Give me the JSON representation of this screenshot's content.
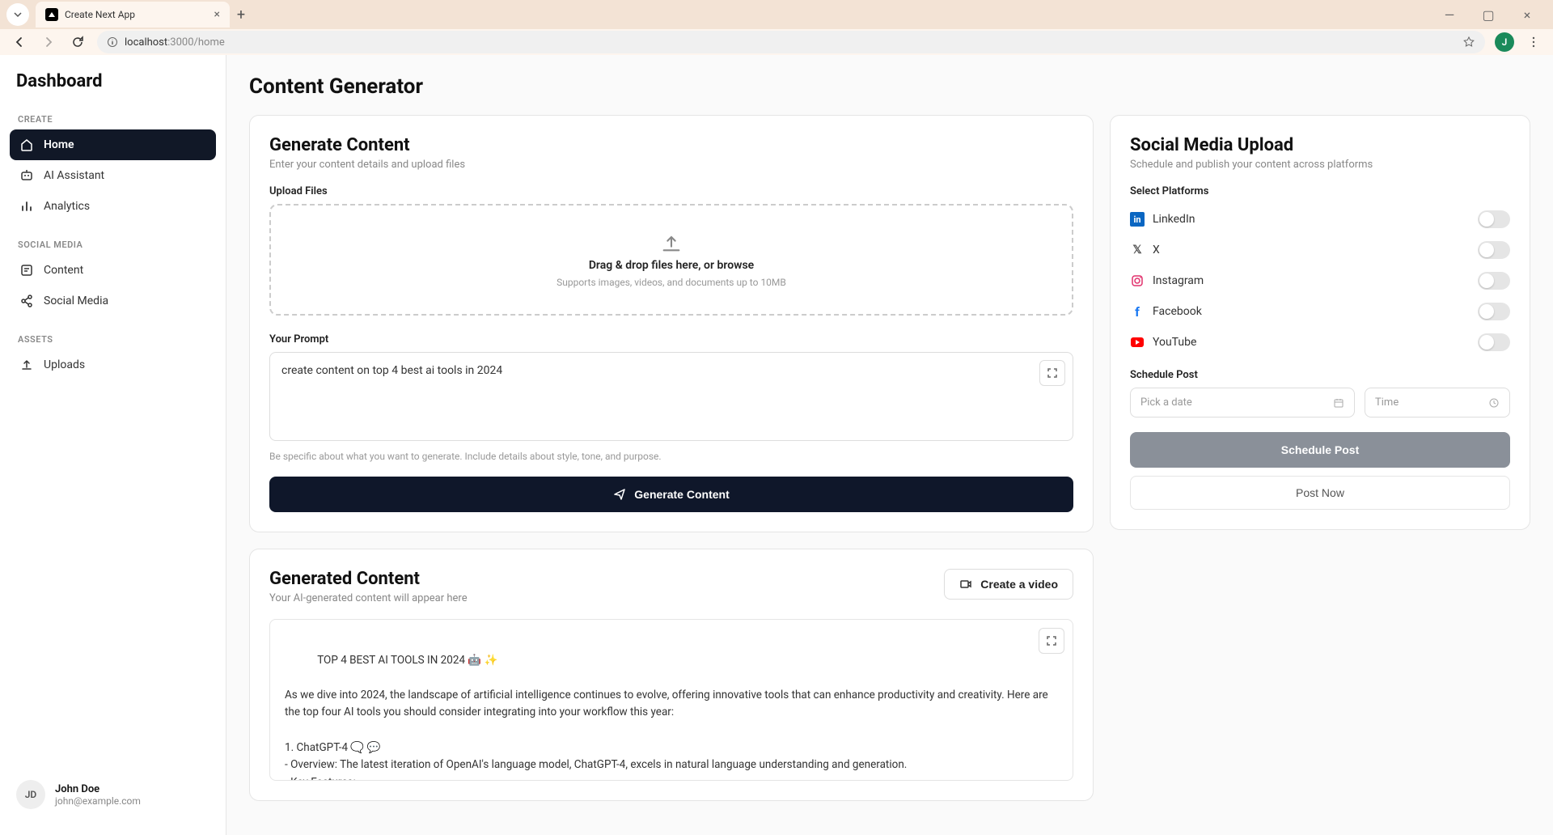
{
  "browser": {
    "tab_title": "Create Next App",
    "url_host": "localhost",
    "url_port": ":3000",
    "url_path": "/home",
    "profile_initial": "J"
  },
  "sidebar": {
    "title": "Dashboard",
    "sections": {
      "create": {
        "label": "CREATE"
      },
      "social": {
        "label": "SOCIAL MEDIA"
      },
      "assets": {
        "label": "ASSETS"
      }
    },
    "items": {
      "home": "Home",
      "ai_assistant": "AI Assistant",
      "analytics": "Analytics",
      "content": "Content",
      "social_media": "Social Media",
      "uploads": "Uploads"
    },
    "user": {
      "initials": "JD",
      "name": "John Doe",
      "email": "john@example.com"
    }
  },
  "page": {
    "title": "Content Generator"
  },
  "generate": {
    "title": "Generate Content",
    "subtitle": "Enter your content details and upload files",
    "upload_label": "Upload Files",
    "dropzone_text": "Drag & drop files here, or browse",
    "dropzone_sub": "Supports images, videos, and documents up to 10MB",
    "prompt_label": "Your Prompt",
    "prompt_value": "create content on top 4 best ai tools in 2024",
    "prompt_hint": "Be specific about what you want to generate. Include details about style, tone, and purpose.",
    "button": "Generate Content"
  },
  "generated": {
    "title": "Generated Content",
    "subtitle": "Your AI-generated content will appear here",
    "video_button": "Create a video",
    "body": "TOP 4 BEST AI TOOLS IN 2024 🤖 ✨\n\nAs we dive into 2024, the landscape of artificial intelligence continues to evolve, offering innovative tools that can enhance productivity and creativity. Here are the top four AI tools you should consider integrating into your workflow this year:\n\n1. ChatGPT-4 🗨️ 💬\n- Overview: The latest iteration of OpenAI's language model, ChatGPT-4, excels in natural language understanding and generation.\n- Key Features:\n- Improved contextual understanding for more relevant responses."
  },
  "social": {
    "title": "Social Media Upload",
    "subtitle": "Schedule and publish your content across platforms",
    "select_label": "Select Platforms",
    "platforms": {
      "linkedin": "LinkedIn",
      "x": "X",
      "instagram": "Instagram",
      "facebook": "Facebook",
      "youtube": "YouTube"
    },
    "schedule_label": "Schedule Post",
    "date_placeholder": "Pick a date",
    "time_placeholder": "Time",
    "schedule_button": "Schedule Post",
    "post_now_button": "Post Now"
  },
  "colors": {
    "linkedin": "#0a66c2",
    "x": "#555555",
    "instagram": "#e1306c",
    "facebook": "#1877f2",
    "youtube": "#ff0000"
  }
}
